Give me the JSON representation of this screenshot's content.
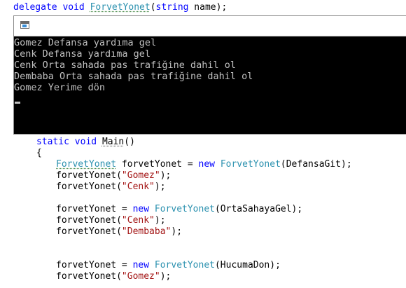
{
  "code": {
    "delegate_line": {
      "kw1": "delegate",
      "kw2": "void",
      "name": "ForvetYonet",
      "paren_open": "(",
      "param_type": "string",
      "param_name": " name);"
    },
    "main_decl": {
      "kw1": "static",
      "kw2": "void",
      "name": "Main",
      "rest": "()"
    },
    "brace_open": "{",
    "line_decl": {
      "type": "ForvetYonet",
      "mid": " forvetYonet = ",
      "kw": "new",
      "ctor": "ForvetYonet",
      "arg": "(DefansaGit);"
    },
    "call_gomez_1": {
      "pre": "forvetYonet(",
      "str": "\"Gomez\"",
      "post": ");"
    },
    "call_cenk_1": {
      "pre": "forvetYonet(",
      "str": "\"Cenk\"",
      "post": ");"
    },
    "assign_orta": {
      "pre": "forvetYonet = ",
      "kw": "new",
      "ctor": "ForvetYonet",
      "arg": "(OrtaSahayaGel);"
    },
    "call_cenk_2": {
      "pre": "forvetYonet(",
      "str": "\"Cenk\"",
      "post": ");"
    },
    "call_dembaba": {
      "pre": "forvetYonet(",
      "str": "\"Dembaba\"",
      "post": ");"
    },
    "assign_hucum": {
      "pre": "forvetYonet = ",
      "kw": "new",
      "ctor": "ForvetYonet",
      "arg": "(HucumaDon);"
    },
    "call_gomez_2": {
      "pre": "forvetYonet(",
      "str": "\"Gomez\"",
      "post": ");"
    }
  },
  "console": {
    "lines": [
      "Gomez Defansa yardıma gel",
      "Cenk Defansa yardıma gel",
      "Cenk Orta sahada pas trafiğine dahil ol",
      "Dembaba Orta sahada pas trafiğine dahil ol",
      "Gomez Yerime dön"
    ]
  },
  "colors": {
    "keyword": "#0000ff",
    "type": "#2b91af",
    "string": "#a31515",
    "console_bg": "#000000",
    "console_text": "#c0c0c0"
  }
}
